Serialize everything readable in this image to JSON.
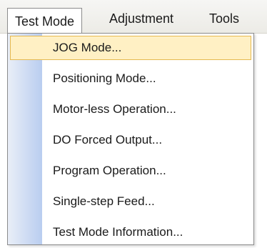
{
  "menubar": {
    "items": [
      {
        "label": "Test Mode",
        "active": true
      },
      {
        "label": "Adjustment",
        "active": false
      },
      {
        "label": "Tools",
        "active": false
      }
    ]
  },
  "dropdown": {
    "items": [
      {
        "label": "JOG Mode...",
        "highlighted": true
      },
      {
        "label": "Positioning Mode...",
        "highlighted": false
      },
      {
        "label": "Motor-less Operation...",
        "highlighted": false
      },
      {
        "label": "DO Forced Output...",
        "highlighted": false
      },
      {
        "label": "Program Operation...",
        "highlighted": false
      },
      {
        "label": "Single-step Feed...",
        "highlighted": false
      },
      {
        "label": "Test Mode Information...",
        "highlighted": false
      }
    ]
  },
  "colors": {
    "highlight_fill": "#fff0c4",
    "highlight_border": "#e6b94f",
    "gutter_start": "#e9eef7",
    "gutter_end": "#b9cdf0"
  }
}
